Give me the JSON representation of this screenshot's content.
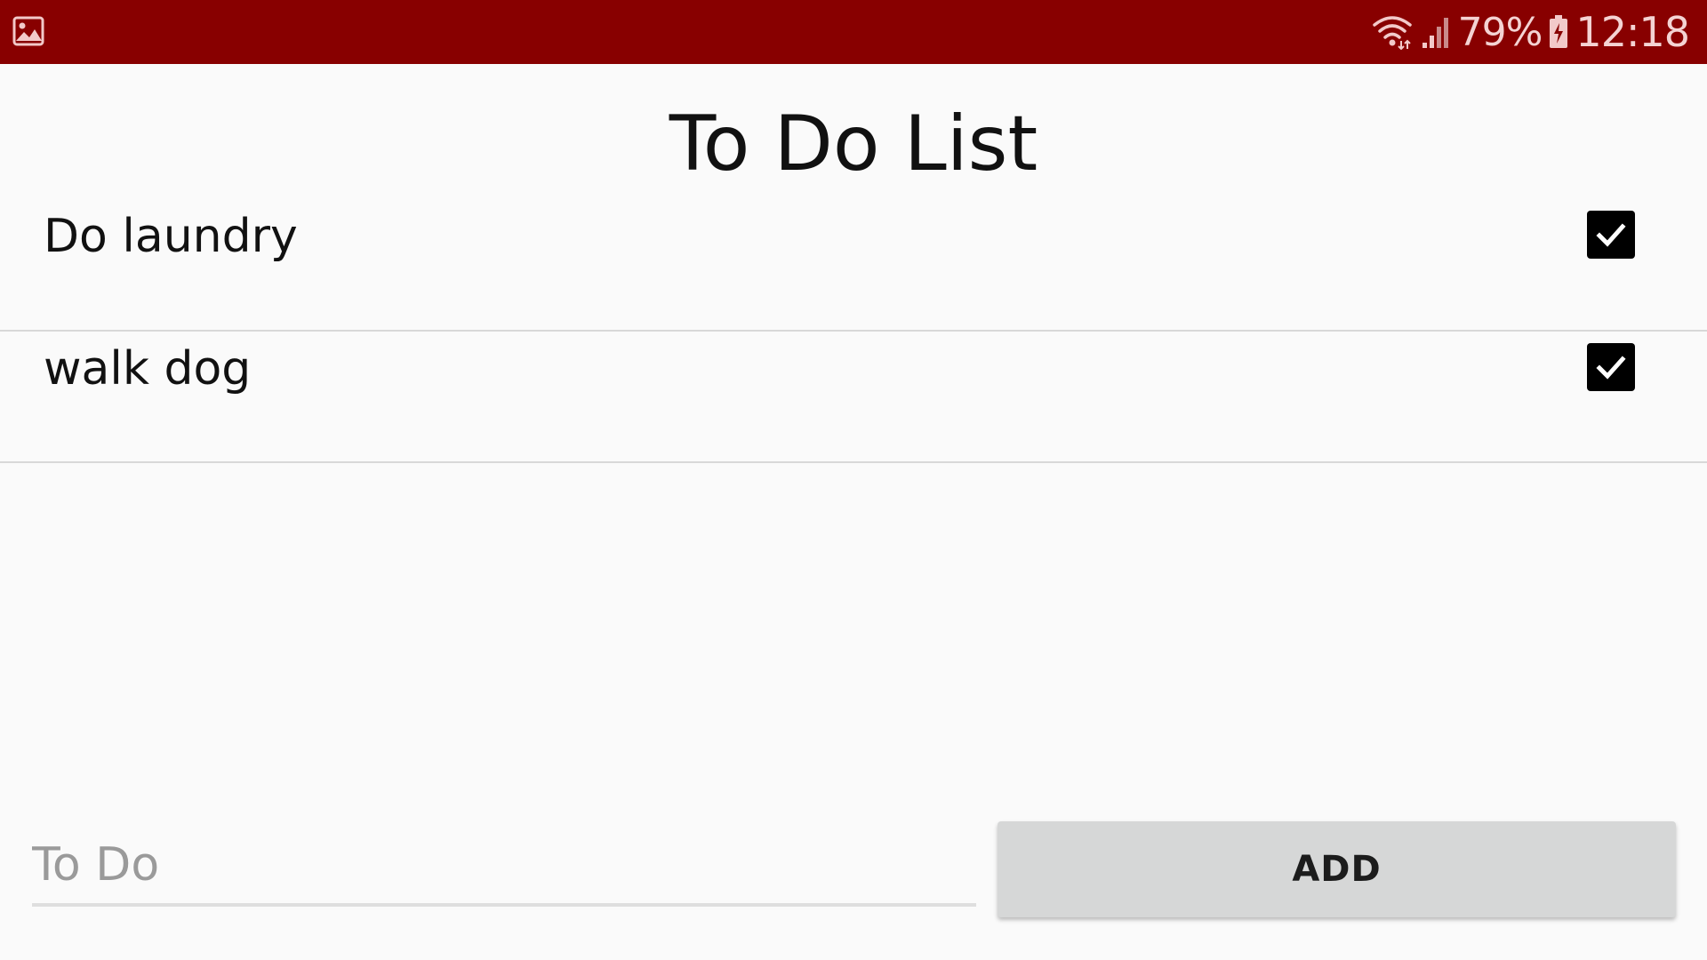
{
  "colors": {
    "status_bar": "#880000",
    "background": "#fafafa",
    "checkbox": "#000000",
    "button": "#d6d7d7"
  },
  "status_bar": {
    "notification_icon": "image-icon",
    "wifi_icon": "wifi-icon",
    "signal_icon": "signal-icon",
    "battery_percent": "79%",
    "battery_icon": "battery-charging-icon",
    "time": "12:18"
  },
  "page": {
    "title": "To Do List"
  },
  "todos": [
    {
      "label": "Do laundry",
      "checked": true
    },
    {
      "label": "walk dog",
      "checked": true
    }
  ],
  "input": {
    "placeholder": "To Do",
    "value": ""
  },
  "add_button": {
    "label": "ADD"
  }
}
